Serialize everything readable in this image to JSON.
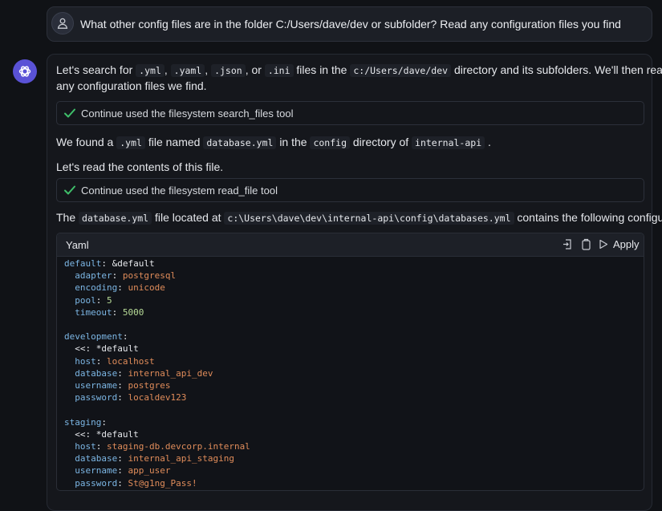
{
  "user_message": "What other config files are in the folder C:/Users/dave/dev or subfolder? Read any configuration files you find",
  "assistant": {
    "intro": {
      "p1": "Let's search for",
      "code1": ".yml",
      "sep1": ",",
      "code2": ".yaml",
      "sep2": ",",
      "code3": ".json",
      "sep3": ", or",
      "code4": ".ini",
      "p2": "files in the",
      "code5": "c:/Users/dave/dev",
      "p3": "directory and its subfolders. We'll then read",
      "line2": "any configuration files we find."
    },
    "tool1": "Continue used the filesystem search_files tool",
    "found": {
      "p1": "We found a",
      "code1": ".yml",
      "p2": "file named",
      "code2": "database.yml",
      "p3": "in the",
      "code3": "config",
      "p4": "directory of",
      "code4": "internal-api",
      "p5": "."
    },
    "read_text": "Let's read the contents of this file.",
    "tool2": "Continue used the filesystem read_file tool",
    "file_line": {
      "p1": "The",
      "code1": "database.yml",
      "p2": "file located at",
      "code2": "c:\\Users\\dave\\dev\\internal-api\\config\\databases.yml",
      "p3": "contains the following configuration:"
    },
    "code_block": {
      "language": "Yaml",
      "apply_label": "Apply",
      "lines": {
        "l1k": "default",
        "l1v": "&default",
        "l2k": "adapter",
        "l2v": "postgresql",
        "l3k": "encoding",
        "l3v": "unicode",
        "l4k": "pool",
        "l4v": "5",
        "l5k": "timeout",
        "l5v": "5000",
        "l6k": "development",
        "l7": "<<: *default",
        "l8k": "host",
        "l8v": "localhost",
        "l9k": "database",
        "l9v": "internal_api_dev",
        "l10k": "username",
        "l10v": "postgres",
        "l11k": "password",
        "l11v": "localdev123",
        "l12k": "staging",
        "l13": "<<: *default",
        "l14k": "host",
        "l14v": "staging-db.devcorp.internal",
        "l15k": "database",
        "l15v": "internal_api_staging",
        "l16k": "username",
        "l16v": "app_user",
        "l17k": "password",
        "l17v": "St@g1ng_Pass!"
      }
    }
  },
  "colors": {
    "background": "#101216",
    "bot_avatar": "#5a52d6",
    "check_green": "#3fbf6a",
    "yaml_key": "#7cb6e4",
    "yaml_string": "#e08c5a",
    "yaml_number": "#b8dc98"
  }
}
